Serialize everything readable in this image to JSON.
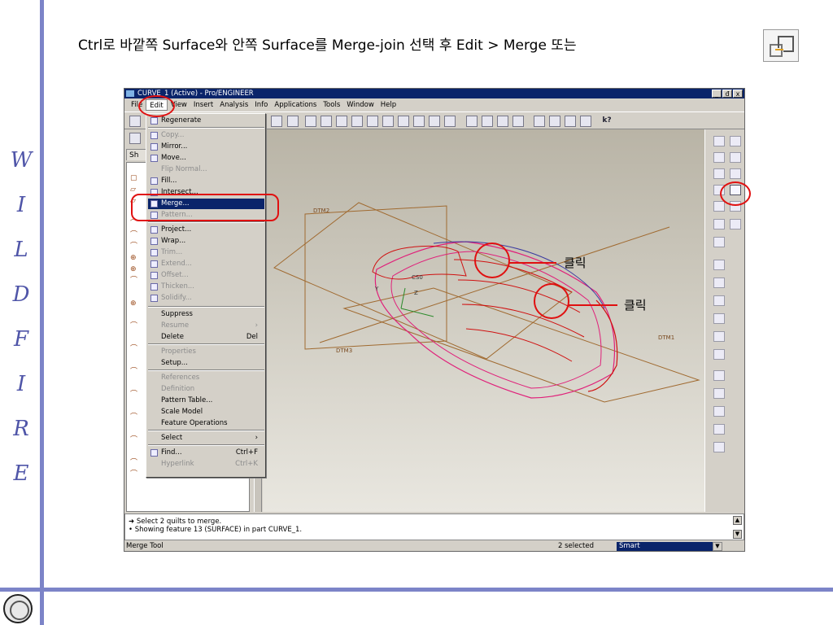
{
  "slide": {
    "instruction": "Ctrl로 바깥쪽 Surface와 안쪽 Surface를 Merge-join 선택 후  Edit > Merge  또는",
    "side_title_letters": [
      "W",
      "I",
      "L",
      "D",
      "F",
      "I",
      "R",
      "E"
    ],
    "click_label_1": "클릭",
    "click_label_2": "클릭",
    "annotation_color": "#e01010",
    "accent_color": "#7c84c8"
  },
  "window": {
    "title": "CURVE_1 (Active) - Pro/ENGINEER",
    "controls": [
      "_",
      "đ",
      "x"
    ]
  },
  "menubar": [
    "File",
    "Edit",
    "View",
    "Insert",
    "Analysis",
    "Info",
    "Applications",
    "Tools",
    "Window",
    "Help"
  ],
  "edit_menu": {
    "items": [
      {
        "label": "Regenerate",
        "shortcut": "",
        "disabled": false
      },
      {
        "label": "Copy...",
        "shortcut": "",
        "disabled": true
      },
      {
        "label": "Mirror...",
        "shortcut": "",
        "disabled": false
      },
      {
        "label": "Move...",
        "shortcut": "",
        "disabled": false
      },
      {
        "label": "Flip Normal...",
        "shortcut": "",
        "disabled": true
      },
      {
        "label": "Fill...",
        "shortcut": "",
        "disabled": false
      },
      {
        "label": "Intersect...",
        "shortcut": "",
        "disabled": false
      },
      {
        "label": "Merge...",
        "shortcut": "",
        "disabled": false,
        "selected": true
      },
      {
        "label": "Pattern...",
        "shortcut": "",
        "disabled": true
      },
      {
        "label": "Project...",
        "shortcut": "",
        "disabled": false
      },
      {
        "label": "Wrap...",
        "shortcut": "",
        "disabled": false
      },
      {
        "label": "Trim...",
        "shortcut": "",
        "disabled": true
      },
      {
        "label": "Extend...",
        "shortcut": "",
        "disabled": true
      },
      {
        "label": "Offset...",
        "shortcut": "",
        "disabled": true
      },
      {
        "label": "Thicken...",
        "shortcut": "",
        "disabled": true
      },
      {
        "label": "Solidify...",
        "shortcut": "",
        "disabled": true
      },
      {
        "label": "Suppress",
        "shortcut": "",
        "disabled": false
      },
      {
        "label": "Resume",
        "shortcut": "›",
        "disabled": true
      },
      {
        "label": "Delete",
        "shortcut": "Del",
        "disabled": false
      },
      {
        "label": "Properties",
        "shortcut": "",
        "disabled": true
      },
      {
        "label": "Setup...",
        "shortcut": "",
        "disabled": false
      },
      {
        "label": "References",
        "shortcut": "",
        "disabled": true
      },
      {
        "label": "Definition",
        "shortcut": "",
        "disabled": true
      },
      {
        "label": "Pattern Table...",
        "shortcut": "",
        "disabled": false
      },
      {
        "label": "Scale Model",
        "shortcut": "",
        "disabled": false
      },
      {
        "label": "Feature Operations",
        "shortcut": "",
        "disabled": false
      },
      {
        "label": "Select",
        "shortcut": "›",
        "disabled": false
      },
      {
        "label": "Find...",
        "shortcut": "Ctrl+F",
        "disabled": false
      },
      {
        "label": "Hyperlink",
        "shortcut": "Ctrl+K",
        "disabled": true
      }
    ]
  },
  "model_tree": {
    "tab_label": "Sh"
  },
  "viewport": {
    "datum_labels": [
      "DTM2",
      "DTM3",
      "DTM1",
      "CS0"
    ],
    "axis_labels": [
      "Y",
      "Z"
    ]
  },
  "messages": {
    "line1": "Select 2 quilts to merge.",
    "line2": "Showing feature 13 (SURFACE) in part CURVE_1."
  },
  "status": {
    "tool": "Merge Tool",
    "selected": "2 selected",
    "filter": "Smart"
  }
}
